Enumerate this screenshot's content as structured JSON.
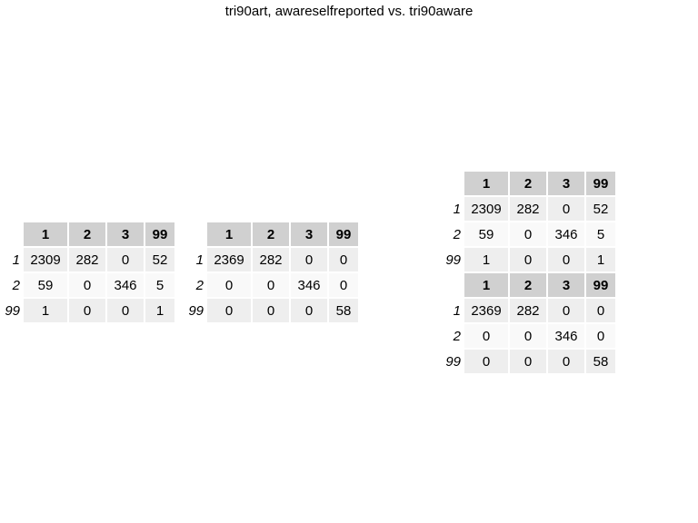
{
  "title": "tri90art, awareselfreported vs. tri90aware",
  "tables": [
    {
      "columns": [
        "1",
        "2",
        "3",
        "99"
      ],
      "rows": [
        {
          "label": "1",
          "values": [
            "2309",
            "282",
            "0",
            "52"
          ]
        },
        {
          "label": "2",
          "values": [
            "59",
            "0",
            "346",
            "5"
          ]
        },
        {
          "label": "99",
          "values": [
            "1",
            "0",
            "0",
            "1"
          ]
        }
      ]
    },
    {
      "columns": [
        "1",
        "2",
        "3",
        "99"
      ],
      "rows": [
        {
          "label": "1",
          "values": [
            "2369",
            "282",
            "0",
            "0"
          ]
        },
        {
          "label": "2",
          "values": [
            "0",
            "0",
            "346",
            "0"
          ]
        },
        {
          "label": "99",
          "values": [
            "0",
            "0",
            "0",
            "58"
          ]
        }
      ]
    },
    {
      "columns": [
        "1",
        "2",
        "3",
        "99"
      ],
      "rows": [
        {
          "label": "1",
          "values": [
            "2309",
            "282",
            "0",
            "52"
          ]
        },
        {
          "label": "2",
          "values": [
            "59",
            "0",
            "346",
            "5"
          ]
        },
        {
          "label": "99",
          "values": [
            "1",
            "0",
            "0",
            "1"
          ]
        }
      ]
    },
    {
      "columns": [
        "1",
        "2",
        "3",
        "99"
      ],
      "rows": [
        {
          "label": "1",
          "values": [
            "2369",
            "282",
            "0",
            "0"
          ]
        },
        {
          "label": "2",
          "values": [
            "0",
            "0",
            "346",
            "0"
          ]
        },
        {
          "label": "99",
          "values": [
            "0",
            "0",
            "0",
            "58"
          ]
        }
      ]
    }
  ]
}
